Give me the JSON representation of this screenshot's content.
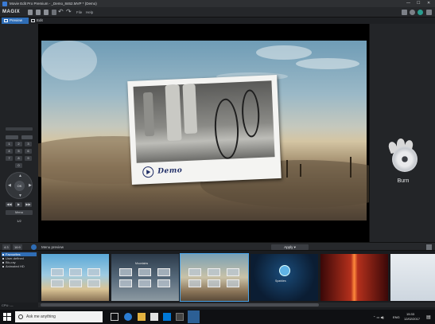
{
  "window": {
    "title": "Movie Edit Pro Premium - _Demo_8462.MVP * (Demo)",
    "controls": [
      "—",
      "☐",
      "✕"
    ]
  },
  "toolbar": {
    "logo": "MAGIX",
    "menu_file": "File",
    "menu_help": "Help",
    "icons": [
      "new-file-icon",
      "open-icon",
      "save-icon",
      "settings-icon",
      "undo-icon",
      "redo-icon",
      "notification-icon",
      "help-icon",
      "account-icon",
      "upload-icon"
    ]
  },
  "tabs": [
    {
      "label": "Preview",
      "active": true
    },
    {
      "label": "Edit",
      "active": false
    }
  ],
  "remote": {
    "digits": [
      "1",
      "2",
      "3",
      "4",
      "5",
      "6",
      "7",
      "8",
      "9",
      "0"
    ],
    "ok_label": "OK",
    "menu_label": "Menu",
    "page_label": "1/2"
  },
  "preview": {
    "demo_text": "Demo"
  },
  "burn": {
    "label": "Burn"
  },
  "menubar": {
    "label": "Menu preview",
    "apply_label": "Apply",
    "left_box_1": "4:3",
    "left_box_2": "16:9"
  },
  "categories": [
    {
      "label": "Favourites",
      "selected": true
    },
    {
      "label": "User-defined",
      "selected": false
    },
    {
      "label": "Blu-ray",
      "selected": false
    },
    {
      "label": "Animated HD",
      "selected": false
    }
  ],
  "thumbnails": [
    {
      "name": "sky-template",
      "caption": "",
      "selected": false
    },
    {
      "name": "mountains-template",
      "caption": "Mountains",
      "selected": false
    },
    {
      "name": "desert-template",
      "caption": "",
      "selected": true
    },
    {
      "name": "sparkles-template",
      "caption": "Sparkles",
      "selected": false
    },
    {
      "name": "red-curtain-template",
      "caption": "",
      "selected": false
    },
    {
      "name": "white-template",
      "caption": "",
      "selected": false
    }
  ],
  "statusbar": {
    "cpu_label": "CPU: —"
  },
  "taskbar": {
    "search_placeholder": "Ask me anything",
    "search_text": "Ask me anything",
    "language": "ENG",
    "time": "15:33",
    "date": "12/02/2017"
  }
}
